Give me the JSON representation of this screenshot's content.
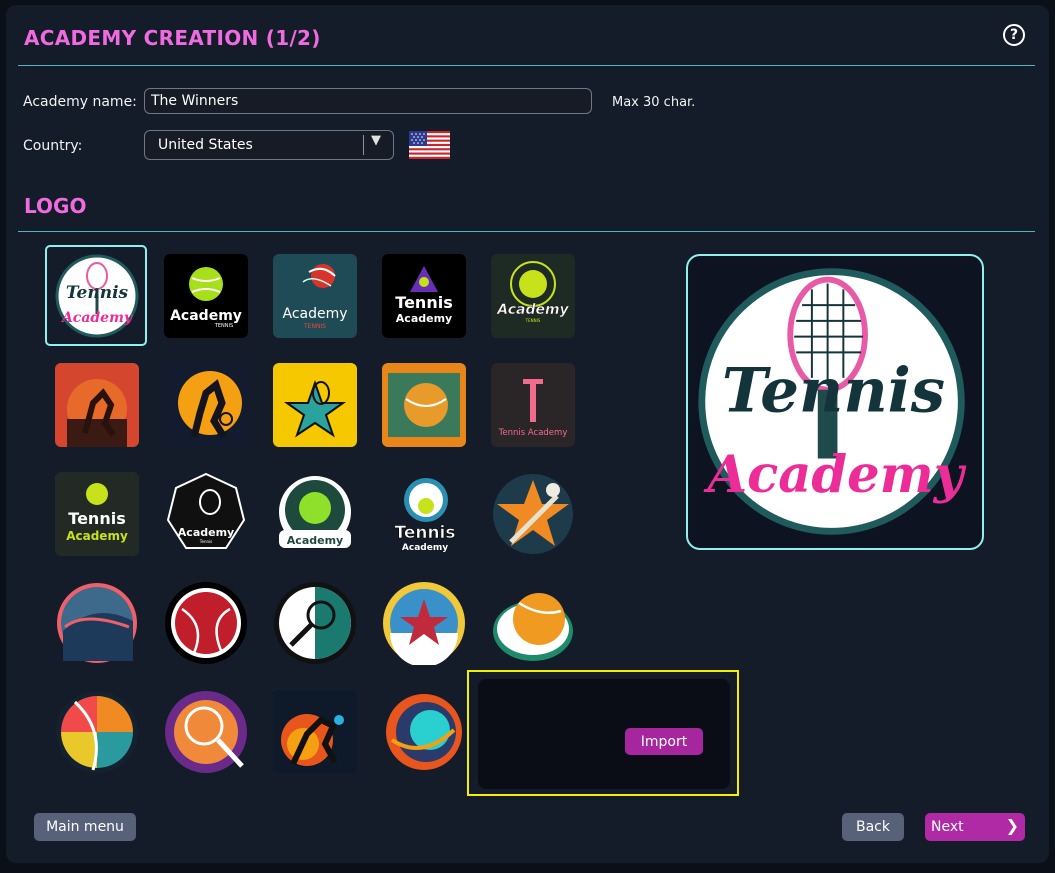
{
  "header": {
    "title": "ACADEMY CREATION (1/2)",
    "help_icon": "?"
  },
  "form": {
    "name_label": "Academy name:",
    "name_value": "The Winners",
    "name_hint": "Max 30 char.",
    "country_label": "Country:",
    "country_value": "United States",
    "flag_icon": "us-flag-icon"
  },
  "logo_section": {
    "title": "LOGO",
    "selected_index": 0
  },
  "logos": {
    "l1": {
      "top": "Tennis",
      "bottom": "Academy"
    },
    "l2": {
      "text": "Academy",
      "sub": "TENNIS"
    },
    "l3": {
      "text": "Academy",
      "sub": "TENNIS"
    },
    "l4": {
      "text": "Tennis",
      "sub": "Academy"
    },
    "l5": {
      "text": "Academy",
      "sub": "TENNIS"
    },
    "l10": {
      "text": "Tennis Academy"
    },
    "l11": {
      "text": "Tennis",
      "sub": "Academy"
    },
    "l12": {
      "text": "Academy",
      "sub": "Tennis"
    },
    "l13": {
      "text": "Academy"
    },
    "l14": {
      "text": "Tennis",
      "sub": "Academy"
    }
  },
  "preview": {
    "top": "Tennis",
    "bottom": "Academy"
  },
  "import": {
    "label": "Import"
  },
  "footer": {
    "main_menu": "Main menu",
    "back": "Back",
    "next": "Next"
  },
  "colors": {
    "accent_pink": "#f06be0",
    "teal": "#8ff0ee",
    "highlight": "#f5f000"
  }
}
